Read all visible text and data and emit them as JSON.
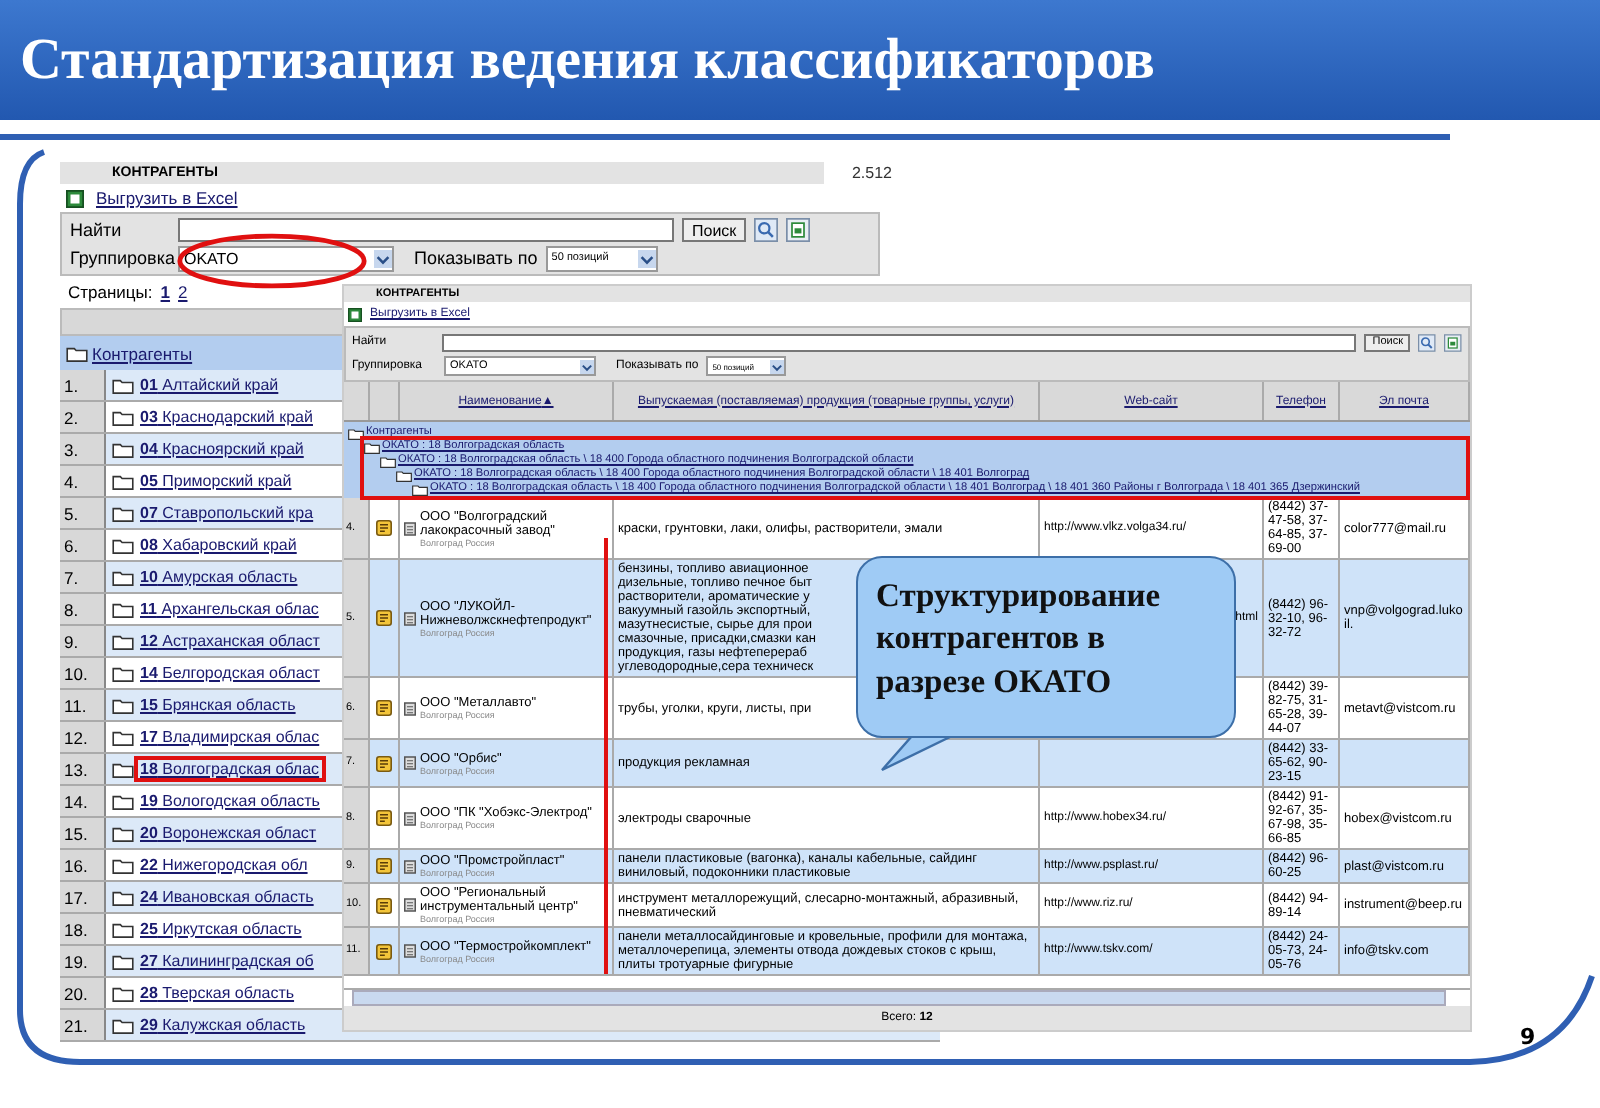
{
  "title": "Стандартизация ведения классификаторов",
  "page_number": "9",
  "back_window": {
    "header": "КОНТРАГЕНТЫ",
    "count": "2.512",
    "export_link": "Выгрузить в Excel",
    "search": {
      "label": "Найти",
      "button": "Поиск"
    },
    "grouping": {
      "label": "Группировка",
      "value": "OKATO",
      "highlighted": true
    },
    "show_by": {
      "label": "Показывать по",
      "value": "50 позиций"
    },
    "pages": {
      "label": "Страницы:",
      "items": [
        {
          "label": "1",
          "selected": true
        },
        {
          "label": "2",
          "selected": false
        }
      ]
    },
    "tree_root": "Контрагенты",
    "regions": [
      {
        "num": "1.",
        "code": "01",
        "name": "Алтайский край",
        "highlighted": false
      },
      {
        "num": "2.",
        "code": "03",
        "name": "Краснодарский край",
        "highlighted": false
      },
      {
        "num": "3.",
        "code": "04",
        "name": "Красноярский край",
        "highlighted": false
      },
      {
        "num": "4.",
        "code": "05",
        "name": "Приморский край",
        "highlighted": false
      },
      {
        "num": "5.",
        "code": "07",
        "name": "Ставропольский кра",
        "highlighted": false
      },
      {
        "num": "6.",
        "code": "08",
        "name": "Хабаровский край",
        "highlighted": false
      },
      {
        "num": "7.",
        "code": "10",
        "name": "Амурская область",
        "highlighted": false
      },
      {
        "num": "8.",
        "code": "11",
        "name": "Архангельская облас",
        "highlighted": false
      },
      {
        "num": "9.",
        "code": "12",
        "name": "Астраханская област",
        "highlighted": false
      },
      {
        "num": "10.",
        "code": "14",
        "name": "Белгородская област",
        "highlighted": false
      },
      {
        "num": "11.",
        "code": "15",
        "name": "Брянская область",
        "highlighted": false
      },
      {
        "num": "12.",
        "code": "17",
        "name": "Владимирская облас",
        "highlighted": false
      },
      {
        "num": "13.",
        "code": "18",
        "name": "Волгоградская облас",
        "highlighted": true
      },
      {
        "num": "14.",
        "code": "19",
        "name": "Вологодская область",
        "highlighted": false
      },
      {
        "num": "15.",
        "code": "20",
        "name": "Воронежская област",
        "highlighted": false
      },
      {
        "num": "16.",
        "code": "22",
        "name": "Нижегородская обл",
        "highlighted": false
      },
      {
        "num": "17.",
        "code": "24",
        "name": "Ивановская область",
        "highlighted": false
      },
      {
        "num": "18.",
        "code": "25",
        "name": "Иркутская область",
        "highlighted": false
      },
      {
        "num": "19.",
        "code": "27",
        "name": "Калининградская об",
        "highlighted": false
      },
      {
        "num": "20.",
        "code": "28",
        "name": "Тверская область",
        "highlighted": false
      },
      {
        "num": "21.",
        "code": "29",
        "name": "Калужская область",
        "highlighted": false
      }
    ]
  },
  "front_window": {
    "header": "КОНТРАГЕНТЫ",
    "export_link": "Выгрузить в Excel",
    "search": {
      "label": "Найти",
      "button": "Поиск"
    },
    "grouping": {
      "label": "Группировка",
      "value": "OKATO"
    },
    "show_by": {
      "label": "Показывать по",
      "value": "50 позиций"
    },
    "columns": [
      {
        "label": "Наименование",
        "sort_mark": "▲"
      },
      {
        "label": "Выпускаемая (поставляемая) продукция (товарные группы, услуги)"
      },
      {
        "label": "Web-сайт"
      },
      {
        "label": "Телефон"
      },
      {
        "label": "Эл почта"
      }
    ],
    "tree": {
      "label": "Контрагенты",
      "highlighted": false,
      "children": [
        {
          "label": "ОКАТО : 18 Волгоградская область",
          "highlighted": true,
          "children": [
            {
              "label": "ОКАТО : 18 Волгоградская область \\ 18 400 Города областного подчинения Волгоградской области",
              "highlighted": false,
              "children": [
                {
                  "label": "ОКАТО : 18 Волгоградская область \\ 18 400 Города областного подчинения Волгоградской области \\ 18 401 Волгоград",
                  "highlighted": false,
                  "children": [
                    {
                      "label": "ОКАТО : 18 Волгоградская область \\ 18 400 Города областного подчинения Волгоградской области \\ 18 401 Волгоград \\ 18 401 360 Районы г Волгограда \\ 18 401 365 Дзержинский",
                      "highlighted": false
                    }
                  ]
                }
              ]
            }
          ]
        }
      ]
    },
    "rows": [
      {
        "num": "4.",
        "name": "ООО \"Волгоградский лакокрасочный завод\"",
        "location": "Волгоград Россия",
        "products": "краски, грунтовки, лаки, олифы, растворители, эмали",
        "web": "http://www.vlkz.volga34.ru/",
        "web_cut": false,
        "phone": "(8442) 37-47-58, 37-64-85, 37-69-00",
        "email": "color777@mail.ru"
      },
      {
        "num": "5.",
        "name": "ООО \"ЛУКОЙЛ-Нижневолжскнефтепродукт\"",
        "location": "Волгоград Россия",
        "products": "бензины, топливо авиационное\nдизельные, топливо печное быт\nрастворители, ароматические у\nвакуумный газойль экспортный,\nмазутнесистые, сырье для прои\nсмазочные, присадки,смазки кан\nпродукция, газы нефтеперераб\nуглеводородные,сера техническ",
        "web": "html",
        "web_cut": true,
        "phone": "(8442) 96-32-10, 96-32-72",
        "email": "vnp@volgograd.lukoil."
      },
      {
        "num": "6.",
        "name": "ООО \"Металлавто\"",
        "location": "Волгоград Россия",
        "products": "трубы, уголки, круги, листы, при",
        "phone": "(8442) 39-82-75, 31-65-28, 39-44-07",
        "email": "metavt@vistcom.ru"
      },
      {
        "num": "7.",
        "name": "ООО \"Орбис\"",
        "location": "Волгоград Россия",
        "products": "продукция рекламная",
        "phone": "(8442) 33-65-62, 90-23-15"
      },
      {
        "num": "8.",
        "name": "ООО \"ПК \"Хобэкс-Электрод\"",
        "location": "Волгоград Россия",
        "products": "электроды сварочные",
        "web": "http://www.hobex34.ru/",
        "web_cut": false,
        "phone": "(8442) 91-92-67, 35-67-98, 35-66-85",
        "email": "hobex@vistcom.ru"
      },
      {
        "num": "9.",
        "name": "ООО \"Промстройпласт\"",
        "location": "Волгоград Россия",
        "products": "панели пластиковые (вагонка), каналы кабельные, сайдинг виниловый, подоконники пластиковые",
        "web": "http://www.psplast.ru/",
        "web_cut": false,
        "phone": "(8442) 96-60-25",
        "email": "plast@vistcom.ru"
      },
      {
        "num": "10.",
        "name": "ООО \"Региональный инструментальный центр\"",
        "location": "Волгоград Россия",
        "products": "инструмент металлорежущий, слесарно-монтажный, абразивный, пневматический",
        "web": "http://www.riz.ru/",
        "web_cut": false,
        "phone": "(8442) 94-89-14",
        "email": "instrument@beep.ru"
      },
      {
        "num": "11.",
        "name": "ООО \"Термостройкомплект\"",
        "location": "Волгоград Россия",
        "products": "панели металлосайдинговые и кровельные, профили для монтажа, металлочерепица, элементы отвода дождевых стоков с крыш, плиты тротуарные фигурные",
        "web": "http://www.tskv.com/",
        "web_cut": false,
        "phone": "(8442) 24-05-73, 24-05-76",
        "email": "info@tskv.com"
      }
    ],
    "total": "Всего: **12**"
  },
  "callout": {
    "text": "Структурирование контрагентов в разрезе ОКАТО"
  }
}
